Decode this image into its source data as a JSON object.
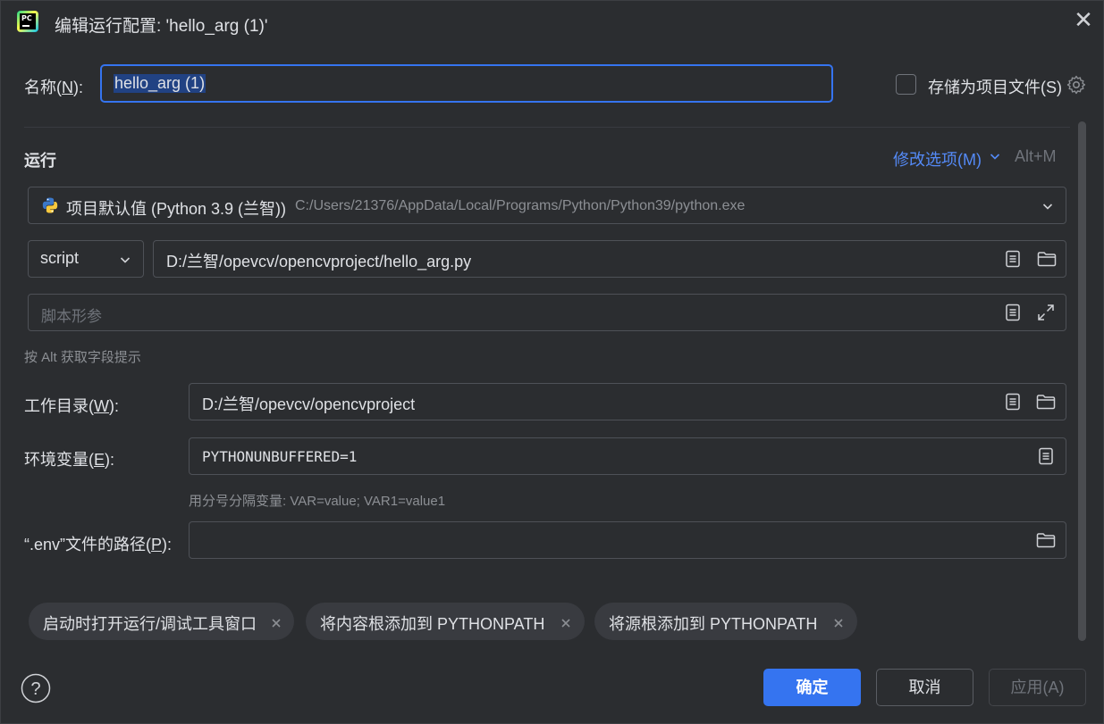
{
  "window": {
    "title": "编辑运行配置: 'hello_arg (1)'",
    "app_icon_text": "PC"
  },
  "name_field": {
    "label_prefix": "名称(",
    "label_key": "N",
    "label_suffix": "):",
    "value": "hello_arg (1)"
  },
  "store_option": {
    "label": "存储为项目文件(S)",
    "checked": false
  },
  "run_section": {
    "title": "运行",
    "modify_options": "修改选项(M)",
    "modify_shortcut": "Alt+M",
    "interpreter_name": "项目默认值 (Python 3.9 (兰智))",
    "interpreter_path": "C:/Users/21376/AppData/Local/Programs/Python/Python39/python.exe",
    "target_type": "script",
    "script_path": "D:/兰智/opevcv/opencvproject/hello_arg.py",
    "params_placeholder": "脚本形参",
    "alt_hint": "按 Alt 获取字段提示"
  },
  "working_dir": {
    "label_prefix": "工作目录(",
    "label_key": "W",
    "label_suffix": "):",
    "value": "D:/兰智/opevcv/opencvproject"
  },
  "env_vars": {
    "label_prefix": "环境变量(",
    "label_key": "E",
    "label_suffix": "):",
    "value": "PYTHONUNBUFFERED=1",
    "hint": "用分号分隔变量: VAR=value; VAR1=value1"
  },
  "dotenv": {
    "label_prefix": "“.env”文件的路径(",
    "label_key": "P",
    "label_suffix": "):",
    "value": ""
  },
  "chips": [
    {
      "label": "启动时打开运行/调试工具窗口"
    },
    {
      "label": "将内容根添加到 PYTHONPATH"
    },
    {
      "label": "将源根添加到 PYTHONPATH"
    }
  ],
  "footer": {
    "help": "?",
    "ok": "确定",
    "cancel": "取消",
    "apply": "应用(A)"
  },
  "colors": {
    "background": "#2b2d30",
    "accent": "#3574f0",
    "link": "#548af7",
    "text": "#dfe1e5",
    "muted": "#8c8f94"
  },
  "icons": {
    "close": "close-icon",
    "gear": "gear-icon",
    "python": "python-icon",
    "dropdown": "chevron-down-icon",
    "list": "list-icon",
    "folder": "folder-icon",
    "expand": "expand-icon",
    "remove": "close-icon",
    "help": "help-icon"
  }
}
